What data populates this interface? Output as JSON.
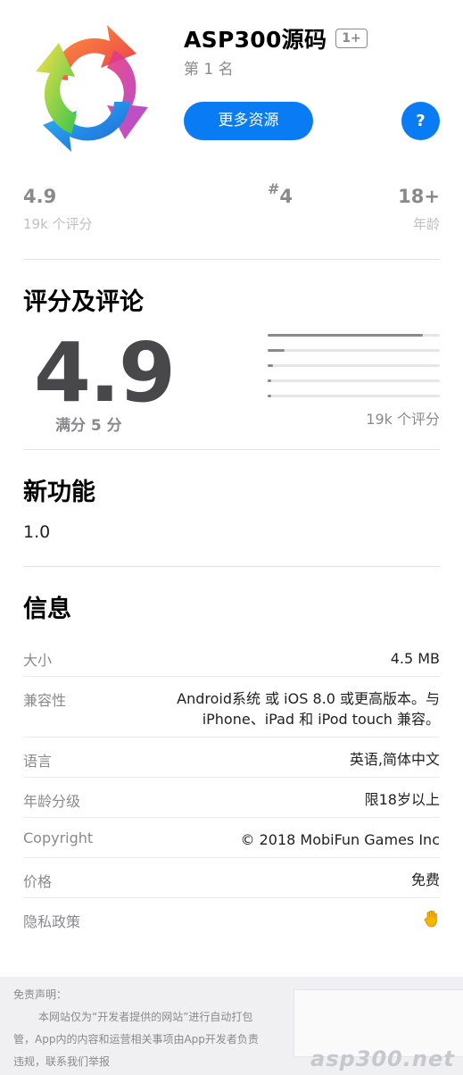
{
  "app": {
    "name": "ASP300源码",
    "age_badge": "1+",
    "rank_text": "第 1 名",
    "more_button": "更多资源",
    "help_button": "?"
  },
  "stats": {
    "rating_value": "4.9",
    "rating_label": "19k 个评分",
    "rank_hash": "#",
    "rank_value": "4",
    "age_value": "18+",
    "age_label": "年龄"
  },
  "ratings": {
    "title": "评分及评论",
    "score": "4.9",
    "out_of": "满分 5 分",
    "count": "19k 个评分",
    "distribution": [
      0.9,
      0.1,
      0.03,
      0.01,
      0.01
    ]
  },
  "whats_new": {
    "title": "新功能",
    "version": "1.0"
  },
  "info": {
    "title": "信息",
    "rows": [
      {
        "label": "大小",
        "value": "4.5 MB"
      },
      {
        "label": "兼容性",
        "value_line1": "Android系统 或 iOS 8.0 或更高版本。与",
        "value_line2": "iPhone、iPad 和 iPod touch 兼容。"
      },
      {
        "label": "语言",
        "value": "英语,简体中文"
      },
      {
        "label": "年龄分级",
        "value": "限18岁以上"
      },
      {
        "label": "Copyright",
        "value": "© 2018 MobiFun Games Inc"
      },
      {
        "label": "价格",
        "value": "免费"
      },
      {
        "label": "隐私政策",
        "icon": "hand-icon"
      }
    ]
  },
  "disclaimer": {
    "title": "免责声明：",
    "line1": "本网站仅为“开发者提供的网站”进行自动打包",
    "line2": "管，App内的内容和运营相关事项由App开发者负责",
    "line3": "违规，联系我们举报",
    "watermark": "asp300.net"
  },
  "colors": {
    "accent": "#0a7cf3",
    "secondary_text": "#8a8a8e",
    "score_text": "#48484a"
  }
}
